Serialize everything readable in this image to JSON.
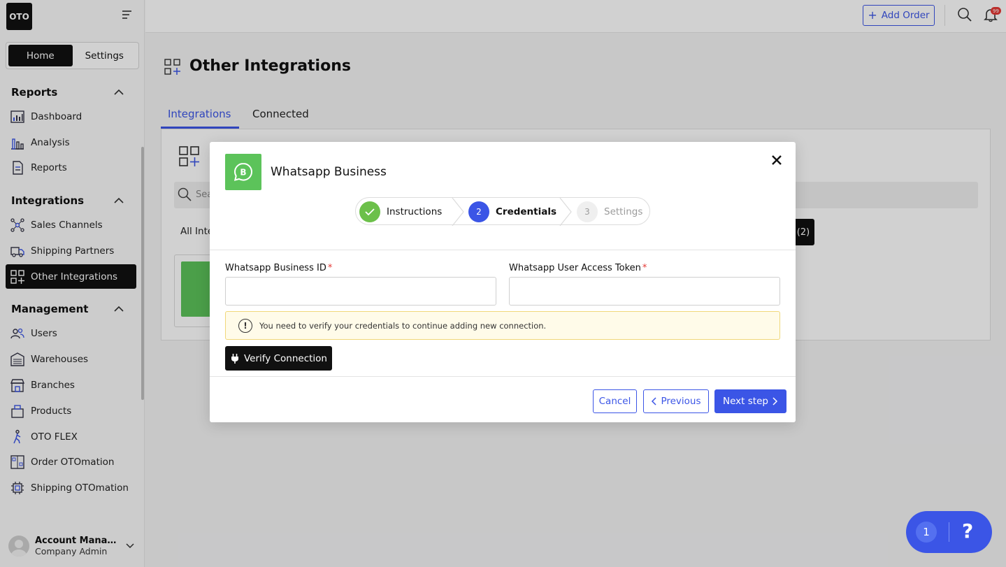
{
  "app": {
    "logo": "OTO"
  },
  "sidebar": {
    "modes": [
      "Home",
      "Settings"
    ],
    "sections": {
      "reports": "Reports",
      "integrations": "Integrations",
      "management": "Management"
    },
    "items": {
      "dashboard": "Dashboard",
      "analysis": "Analysis",
      "reports": "Reports",
      "sales_channels": "Sales Channels",
      "shipping_partners": "Shipping Partners",
      "other_integrations": "Other Integrations",
      "users": "Users",
      "warehouses": "Warehouses",
      "branches": "Branches",
      "products": "Products",
      "oto_flex": "OTO FLEX",
      "order_otomation": "Order OTOmation",
      "shipping_otomation": "Shipping OTOmation"
    },
    "account": {
      "name": "Account Manage...",
      "role": "Company Admin"
    }
  },
  "topbar": {
    "add_order": "Add Order",
    "notifications": "99"
  },
  "page": {
    "title": "Other Integrations",
    "tabs": [
      "Integrations",
      "Connected"
    ],
    "search_placeholder": "Sea",
    "filter_all": "All Inte",
    "filter_connected_count": "(2)"
  },
  "modal": {
    "title": "Whatsapp Business",
    "steps": [
      {
        "num": "",
        "label": "Instructions",
        "state": "done"
      },
      {
        "num": "2",
        "label": "Credentials",
        "state": "active"
      },
      {
        "num": "3",
        "label": "Settings",
        "state": "pending"
      }
    ],
    "fields": {
      "business_id_label": "Whatsapp Business ID",
      "token_label": "Whatsapp User Access Token",
      "required_mark": "*"
    },
    "alert": "You need to verify your credentials to continue adding new connection.",
    "verify_button": "Verify Connection",
    "buttons": {
      "cancel": "Cancel",
      "previous": "Previous",
      "next": "Next step"
    }
  },
  "help": {
    "count": "1",
    "symbol": "?"
  },
  "colors": {
    "primary": "#3b55e6",
    "whatsapp_green": "#5cc35a",
    "success": "#6cc04a",
    "dark": "#111111"
  }
}
